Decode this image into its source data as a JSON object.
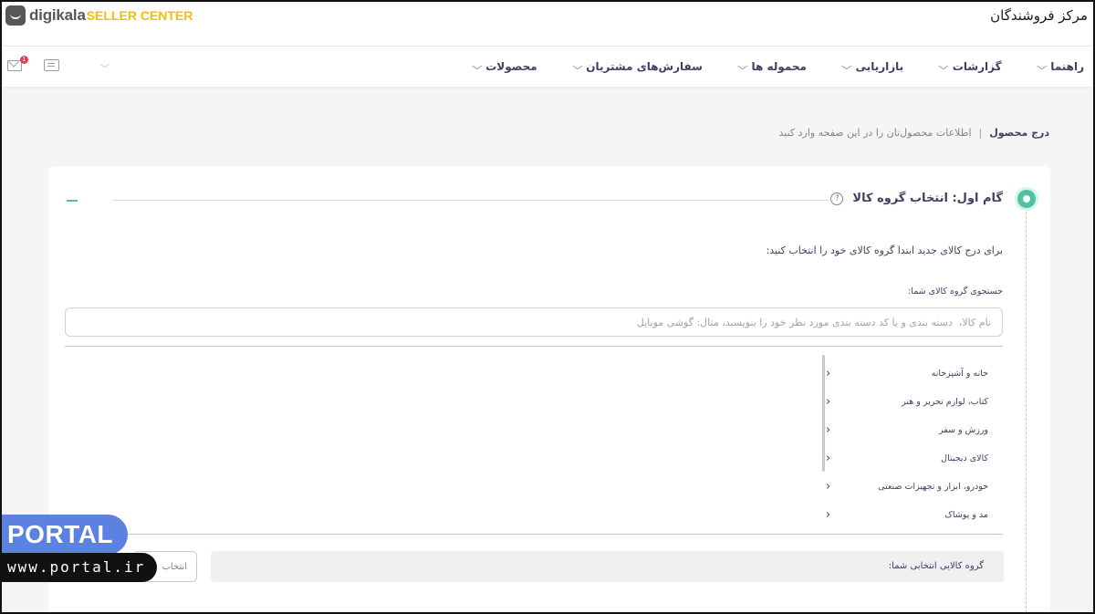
{
  "header": {
    "logo_text": "digikala",
    "logo_sub": "SELLER CENTER",
    "app_title": "مرکز فروشندگان"
  },
  "nav": {
    "items": [
      {
        "label": "محصولات"
      },
      {
        "label": "سفارش‌های مشتریان"
      },
      {
        "label": "محموله ها"
      },
      {
        "label": "بازاریابی"
      },
      {
        "label": "گزارشات"
      },
      {
        "label": "راهنما"
      }
    ],
    "notification_count": "1"
  },
  "breadcrumb": {
    "title": "درج محصول",
    "separator": "|",
    "subtitle": "اطلاعات محصول‌تان را در این صفحه وارد کنید"
  },
  "step": {
    "title": "گام اول: انتخاب گروه کالا",
    "help_symbol": "?",
    "intro": "برای درج کالای جدید ابتدا گروه کالای خود را انتخاب کنید:",
    "search_label": "جستجوی گروه کالای شما:",
    "search_placeholder": "نام کالا،  دسته بندی و یا کد دسته بندی مورد نظر خود را بنویسید، مثال: گوشی موبایل",
    "categories": [
      {
        "label": "خانه و آشپزخانه"
      },
      {
        "label": "کتاب، لوازم تحریر و هنر"
      },
      {
        "label": "ورزش و سفر"
      },
      {
        "label": "کالای دیجیتال"
      },
      {
        "label": "خودرو، ابزار و تجهیزات صنعتی"
      },
      {
        "label": "مد و پوشاک"
      }
    ],
    "selected_label": "گروه کالایی انتخابی شما:",
    "select_button": "انتخاب"
  },
  "watermark": {
    "brand": "PORTAL",
    "url": "www.portal.ir"
  },
  "colors": {
    "accent": "#4fc1a5",
    "badge": "#ef394e",
    "logo_sub": "#f9bc00",
    "text": "#3f4064"
  }
}
